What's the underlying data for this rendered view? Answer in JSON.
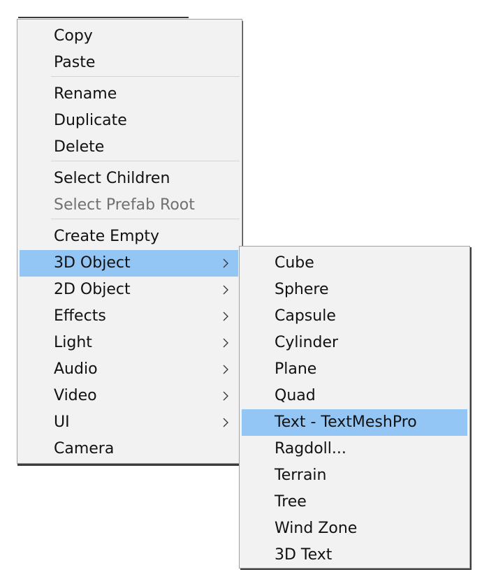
{
  "context_menu": {
    "items": [
      {
        "label": "Copy"
      },
      {
        "label": "Paste"
      },
      {
        "label": "Rename"
      },
      {
        "label": "Duplicate"
      },
      {
        "label": "Delete"
      },
      {
        "label": "Select Children"
      },
      {
        "label": "Select Prefab Root",
        "disabled": true
      },
      {
        "label": "Create Empty"
      },
      {
        "label": "3D Object",
        "submenu": true,
        "selected": true
      },
      {
        "label": "2D Object",
        "submenu": true
      },
      {
        "label": "Effects",
        "submenu": true
      },
      {
        "label": "Light",
        "submenu": true
      },
      {
        "label": "Audio",
        "submenu": true
      },
      {
        "label": "Video",
        "submenu": true
      },
      {
        "label": "UI",
        "submenu": true
      },
      {
        "label": "Camera"
      }
    ]
  },
  "submenu_3d_object": {
    "items": [
      {
        "label": "Cube"
      },
      {
        "label": "Sphere"
      },
      {
        "label": "Capsule"
      },
      {
        "label": "Cylinder"
      },
      {
        "label": "Plane"
      },
      {
        "label": "Quad"
      },
      {
        "label": "Text - TextMeshPro",
        "selected": true
      },
      {
        "label": "Ragdoll..."
      },
      {
        "label": "Terrain"
      },
      {
        "label": "Tree"
      },
      {
        "label": "Wind Zone"
      },
      {
        "label": "3D Text"
      }
    ]
  },
  "icons": {
    "submenu_indicator": "chevron-right-icon"
  },
  "colors": {
    "menu_background": "#f2f2f2",
    "highlight": "#93c6f5",
    "text": "#111111",
    "disabled_text": "#707070",
    "separator": "#d3d3d3"
  }
}
